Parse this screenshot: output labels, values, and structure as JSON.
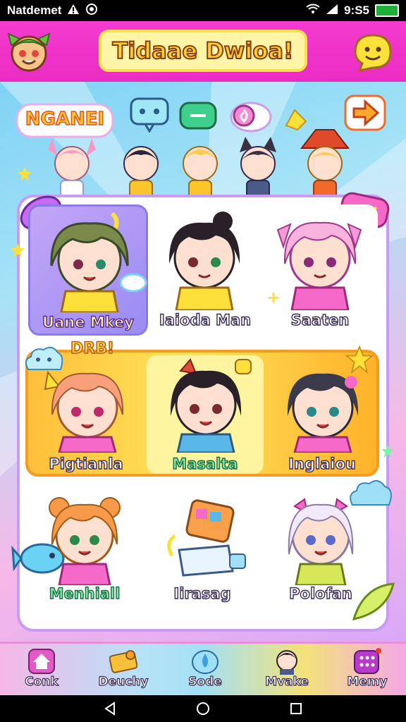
{
  "status_bar": {
    "carrier": "Natdemet",
    "time": "9:S5"
  },
  "header": {
    "title": "Tidaae Dwioa!"
  },
  "banner": {
    "new_badge": "NGANEI"
  },
  "row1": [
    {
      "label": "Uane Mkey",
      "selected": true
    },
    {
      "label": "Iaioda Man",
      "selected": false
    },
    {
      "label": "Saaten",
      "selected": false
    }
  ],
  "row2": {
    "badge": "DRB!",
    "items": [
      {
        "label": "Pigtianla"
      },
      {
        "label": "Masalta"
      },
      {
        "label": "Inglaiou"
      }
    ]
  },
  "row3": [
    {
      "label": "Menhiall"
    },
    {
      "label": "Iirasag"
    },
    {
      "label": "Polofan"
    }
  ],
  "nav": [
    {
      "label": "Conk"
    },
    {
      "label": "Deuchy"
    },
    {
      "label": "Sode"
    },
    {
      "label": "Mvake"
    },
    {
      "label": "Memy"
    }
  ],
  "colors": {
    "header": "#ea2cc3",
    "panel_border": "#c79cf2",
    "row2_bg": "#ffcf3a",
    "title_fill": "#fcd32a"
  }
}
